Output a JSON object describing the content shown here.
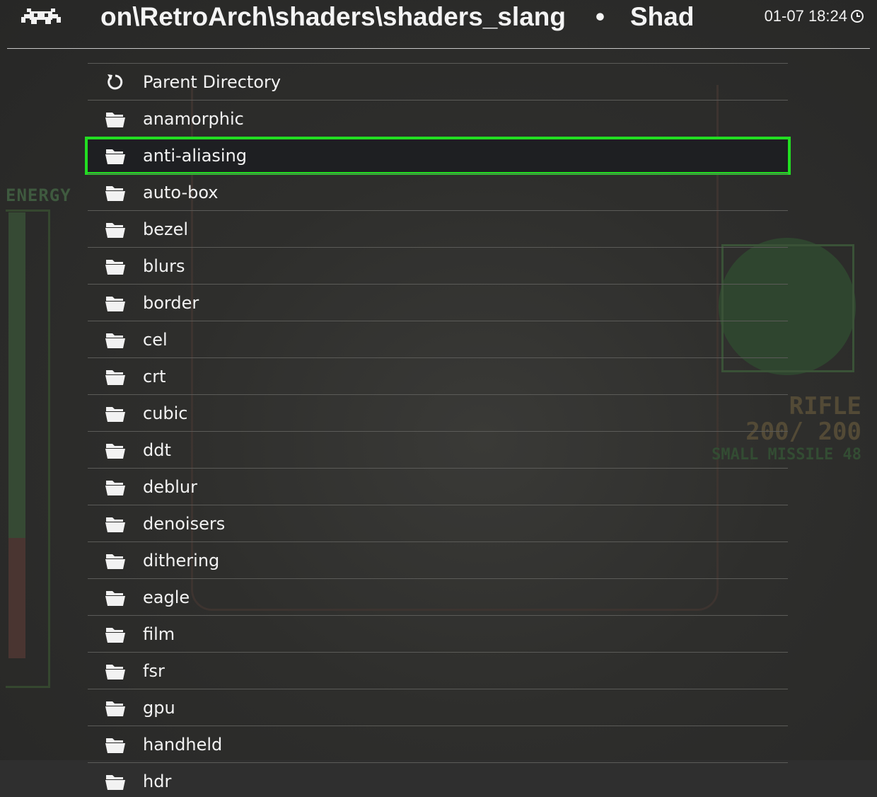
{
  "header": {
    "title_path": "on\\RetroArch\\shaders\\shaders_slang",
    "separator": "•",
    "title_section": "Shad",
    "clock": "01-07 18:24"
  },
  "backdrop": {
    "energy_label": "ENERGY",
    "weapon_name": "RIFLE",
    "weapon_ammo": "200/ 200",
    "sub_weapon": "SMALL MISSILE 48"
  },
  "colors": {
    "selection_border": "#22dd22",
    "text": "#f2f2f2",
    "divider": "#5b5b58"
  },
  "list": {
    "selected_index": 2,
    "items": [
      {
        "label": "Parent Directory",
        "icon": "refresh-icon"
      },
      {
        "label": "anamorphic",
        "icon": "folder-icon"
      },
      {
        "label": "anti-aliasing",
        "icon": "folder-icon"
      },
      {
        "label": "auto-box",
        "icon": "folder-icon"
      },
      {
        "label": "bezel",
        "icon": "folder-icon"
      },
      {
        "label": "blurs",
        "icon": "folder-icon"
      },
      {
        "label": "border",
        "icon": "folder-icon"
      },
      {
        "label": "cel",
        "icon": "folder-icon"
      },
      {
        "label": "crt",
        "icon": "folder-icon"
      },
      {
        "label": "cubic",
        "icon": "folder-icon"
      },
      {
        "label": "ddt",
        "icon": "folder-icon"
      },
      {
        "label": "deblur",
        "icon": "folder-icon"
      },
      {
        "label": "denoisers",
        "icon": "folder-icon"
      },
      {
        "label": "dithering",
        "icon": "folder-icon"
      },
      {
        "label": "eagle",
        "icon": "folder-icon"
      },
      {
        "label": "film",
        "icon": "folder-icon"
      },
      {
        "label": "fsr",
        "icon": "folder-icon"
      },
      {
        "label": "gpu",
        "icon": "folder-icon"
      },
      {
        "label": "handheld",
        "icon": "folder-icon"
      },
      {
        "label": "hdr",
        "icon": "folder-icon"
      }
    ]
  }
}
